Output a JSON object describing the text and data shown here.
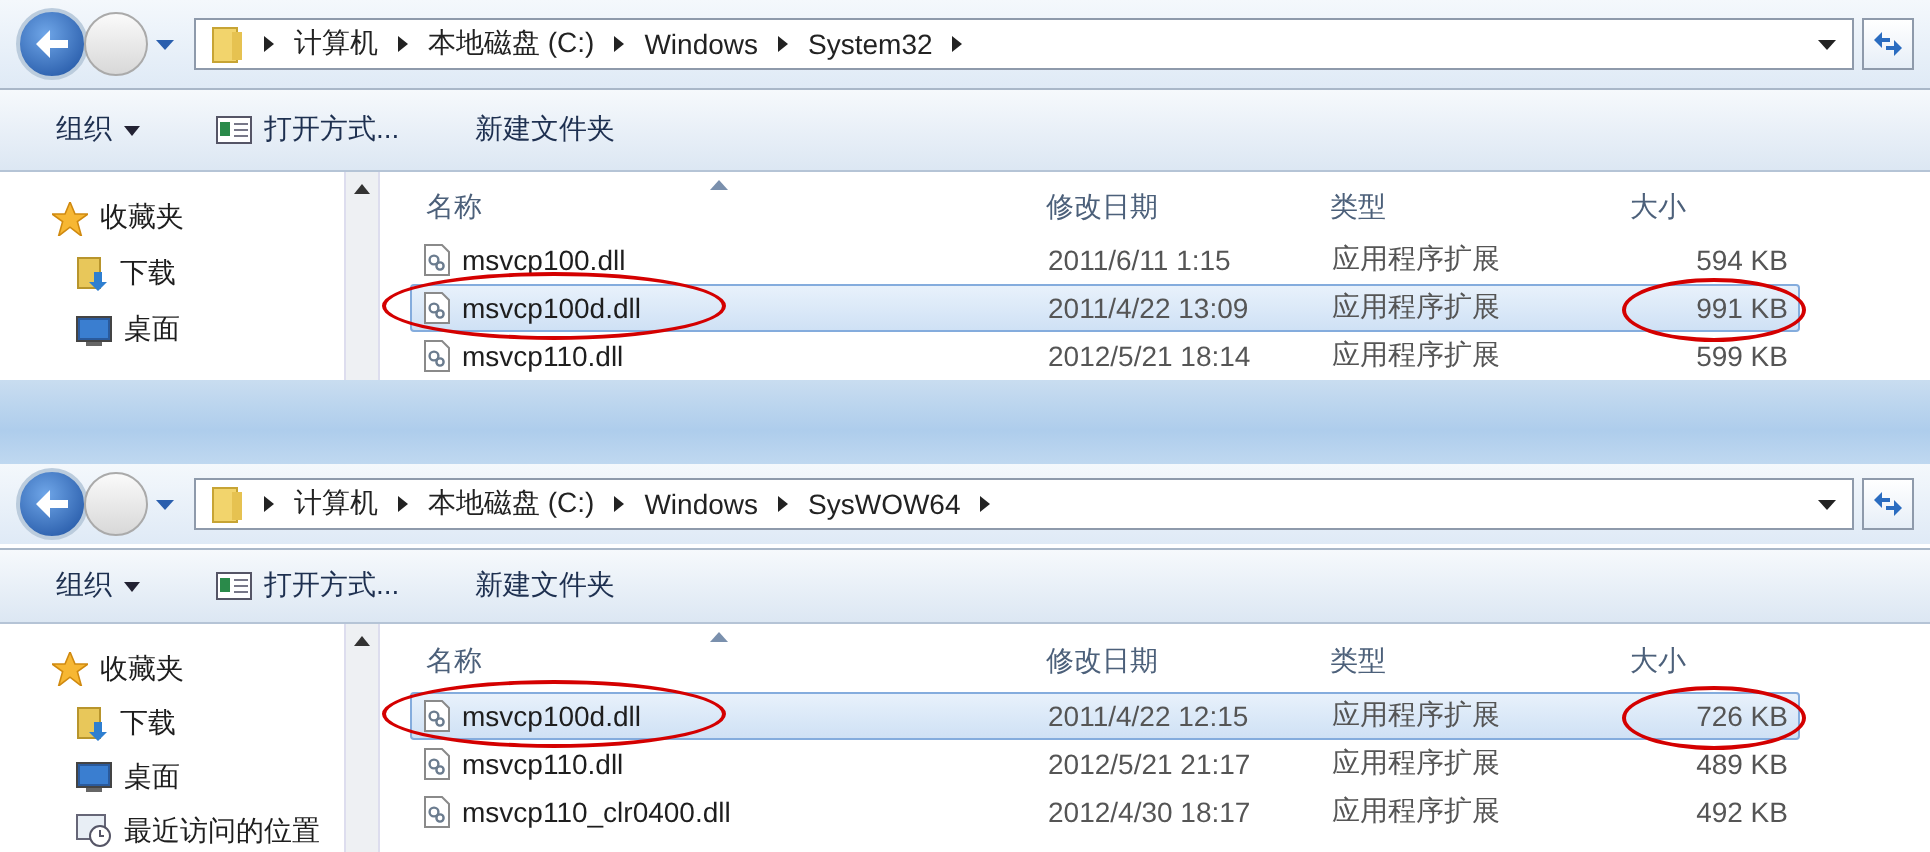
{
  "windows": [
    {
      "address": [
        "计算机",
        "本地磁盘 (C:)",
        "Windows",
        "System32"
      ],
      "toolbar": {
        "organize": "组织",
        "open_with": "打开方式...",
        "new_folder": "新建文件夹"
      },
      "sidebar": [
        {
          "kind": "favorites",
          "label": "收藏夹"
        },
        {
          "kind": "downloads",
          "label": "下载"
        },
        {
          "kind": "desktop",
          "label": "桌面"
        }
      ],
      "columns": [
        "名称",
        "修改日期",
        "类型",
        "大小"
      ],
      "rows": [
        {
          "name": "msvcp100.dll",
          "modified": "2011/6/11 1:15",
          "type": "应用程序扩展",
          "size": "594 KB",
          "selected": false,
          "circled": false
        },
        {
          "name": "msvcp100d.dll",
          "modified": "2011/4/22 13:09",
          "type": "应用程序扩展",
          "size": "991 KB",
          "selected": true,
          "circled": true
        },
        {
          "name": "msvcp110.dll",
          "modified": "2012/5/21 18:14",
          "type": "应用程序扩展",
          "size": "599 KB",
          "selected": false,
          "circled": false
        }
      ]
    },
    {
      "address": [
        "计算机",
        "本地磁盘 (C:)",
        "Windows",
        "SysWOW64"
      ],
      "toolbar": {
        "organize": "组织",
        "open_with": "打开方式...",
        "new_folder": "新建文件夹"
      },
      "sidebar": [
        {
          "kind": "favorites",
          "label": "收藏夹"
        },
        {
          "kind": "downloads",
          "label": "下载"
        },
        {
          "kind": "desktop",
          "label": "桌面"
        },
        {
          "kind": "recent",
          "label": "最近访问的位置"
        }
      ],
      "columns": [
        "名称",
        "修改日期",
        "类型",
        "大小"
      ],
      "rows": [
        {
          "name": "msvcp100d.dll",
          "modified": "2011/4/22 12:15",
          "type": "应用程序扩展",
          "size": "726 KB",
          "selected": true,
          "circled": true
        },
        {
          "name": "msvcp110.dll",
          "modified": "2012/5/21 21:17",
          "type": "应用程序扩展",
          "size": "489 KB",
          "selected": false,
          "circled": false
        },
        {
          "name": "msvcp110_clr0400.dll",
          "modified": "2012/4/30 18:17",
          "type": "应用程序扩展",
          "size": "492 KB",
          "selected": false,
          "circled": false
        }
      ]
    }
  ]
}
